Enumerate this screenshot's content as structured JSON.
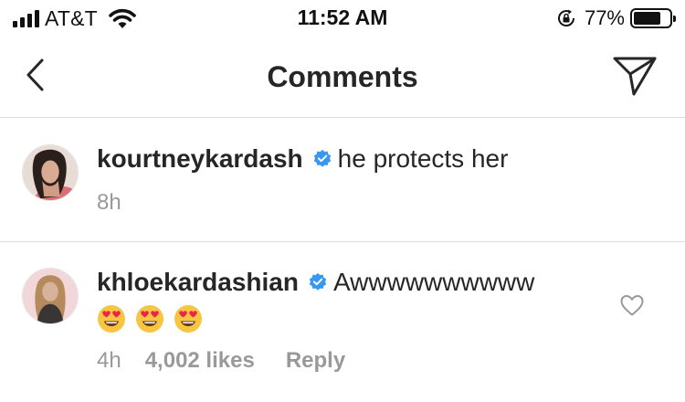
{
  "status_bar": {
    "carrier": "AT&T",
    "time": "11:52 AM",
    "battery_percent": "77%",
    "battery_level": 0.77,
    "signal_bars": 4,
    "icons": [
      "signal-bars-icon",
      "wifi-icon",
      "rotation-lock-icon",
      "battery-icon"
    ]
  },
  "nav": {
    "title": "Comments",
    "back_icon": "chevron-left-icon",
    "send_icon": "paper-plane-icon"
  },
  "comments": [
    {
      "username": "kourtneykardash",
      "verified": true,
      "text": "he protects her",
      "time": "8h"
    },
    {
      "username": "khloekardashian",
      "verified": true,
      "text": "Awwwwwwwwww",
      "emoji": [
        "heart-eyes-emoji",
        "heart-eyes-emoji",
        "heart-eyes-emoji"
      ],
      "time": "4h",
      "likes": "4,002 likes",
      "reply": "Reply",
      "like_icon": "heart-outline-icon"
    }
  ],
  "colors": {
    "text_primary": "#262626",
    "text_secondary": "#999999",
    "divider": "#dbdbdb",
    "verified_blue": "#3897f0"
  }
}
